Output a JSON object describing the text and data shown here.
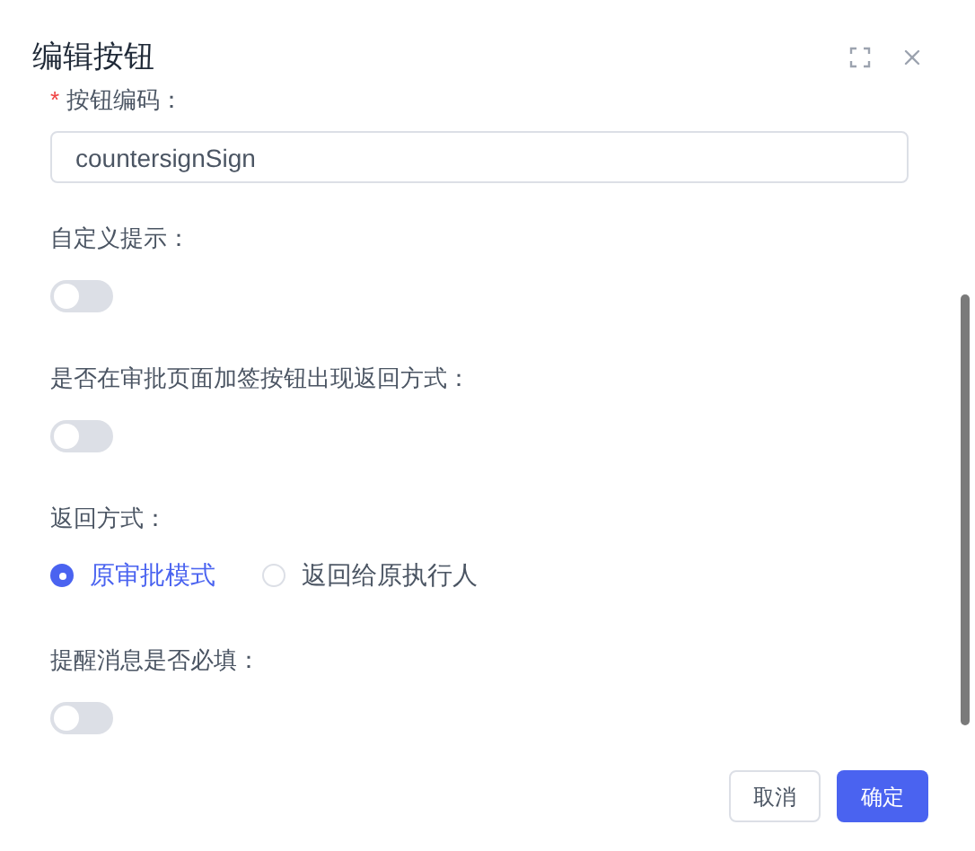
{
  "dialog": {
    "title": "编辑按钮"
  },
  "fields": [
    {
      "kind": "input",
      "label": "按钮编码：",
      "required_mark": "*",
      "value": "countersignSign"
    },
    {
      "kind": "switch",
      "label": "自定义提示：",
      "on": false
    },
    {
      "kind": "switch",
      "label": "是否在审批页面加签按钮出现返回方式：",
      "on": false
    },
    {
      "kind": "radio",
      "label": "返回方式：",
      "options": [
        {
          "label": "原审批模式",
          "selected": true
        },
        {
          "label": "返回给原执行人",
          "selected": false
        }
      ]
    },
    {
      "kind": "switch",
      "label": "提醒消息是否必填：",
      "on": false
    }
  ],
  "buttons": [
    {
      "label": "取消",
      "kind": "default"
    },
    {
      "label": "确定",
      "kind": "primary"
    }
  ]
}
